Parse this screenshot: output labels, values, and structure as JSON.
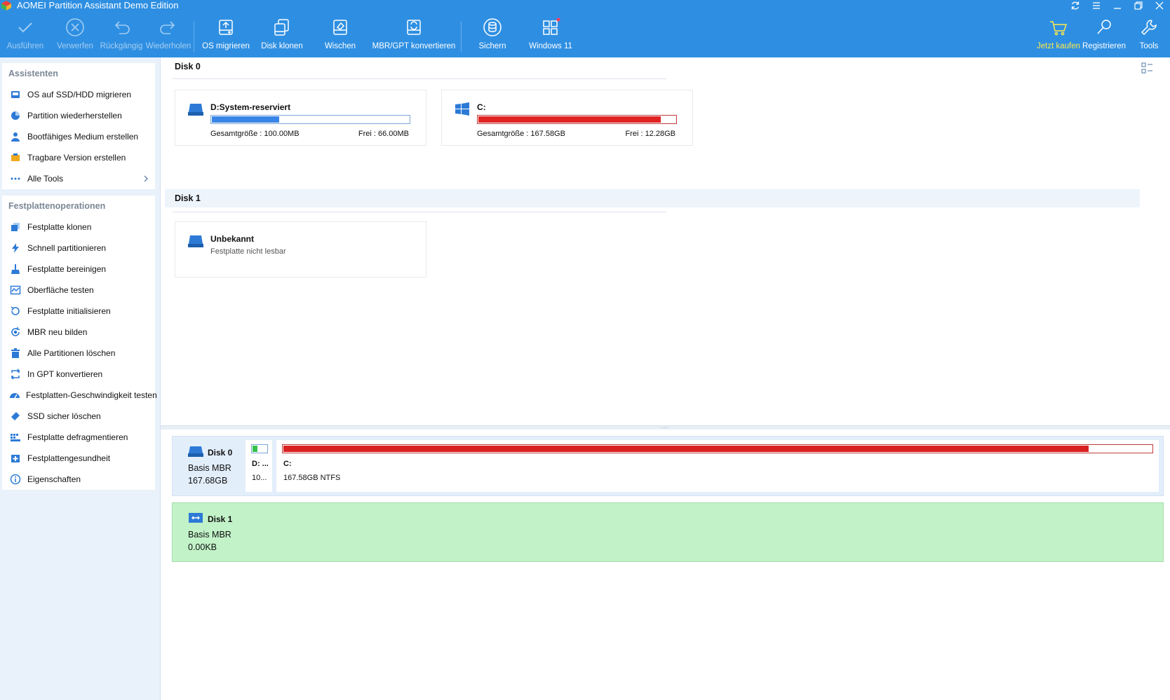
{
  "app": {
    "title": "AOMEI Partition Assistant Demo Edition"
  },
  "toolbar": {
    "items": [
      {
        "label": "Ausführen",
        "icon": "check-icon",
        "enabled": false
      },
      {
        "label": "Verwerfen",
        "icon": "discard-icon",
        "enabled": false
      },
      {
        "label": "Rückgängig",
        "icon": "undo-icon",
        "enabled": false
      },
      {
        "label": "Wiederholen",
        "icon": "redo-icon",
        "enabled": false
      },
      {
        "label": "OS migrieren",
        "icon": "migrate-os-icon",
        "enabled": true
      },
      {
        "label": "Disk klonen",
        "icon": "clone-disk-icon",
        "enabled": true
      },
      {
        "label": "Wischen",
        "icon": "wipe-icon",
        "enabled": true
      },
      {
        "label": "MBR/GPT konvertieren",
        "icon": "convert-icon",
        "enabled": true
      },
      {
        "label": "Sichern",
        "icon": "backup-icon",
        "enabled": true
      },
      {
        "label": "Windows 11",
        "icon": "windows11-icon",
        "enabled": true
      }
    ],
    "right_items": [
      {
        "label": "Jetzt kaufen",
        "icon": "cart-icon"
      },
      {
        "label": "Registrieren",
        "icon": "key-icon"
      },
      {
        "label": "Tools",
        "icon": "tools-icon"
      }
    ]
  },
  "sidebar": {
    "assistants": {
      "heading": "Assistenten",
      "items": [
        {
          "label": "OS auf SSD/HDD migrieren",
          "icon": "migrate-icon"
        },
        {
          "label": "Partition wiederherstellen",
          "icon": "recover-icon"
        },
        {
          "label": "Bootfähiges Medium erstellen",
          "icon": "bootable-media-icon"
        },
        {
          "label": "Tragbare Version erstellen",
          "icon": "portable-icon"
        },
        {
          "label": "Alle Tools",
          "icon": "more-icon"
        }
      ]
    },
    "disk_ops": {
      "heading": "Festplattenoperationen",
      "items": [
        {
          "label": "Festplatte klonen",
          "icon": "clone-icon"
        },
        {
          "label": "Schnell partitionieren",
          "icon": "lightning-icon"
        },
        {
          "label": "Festplatte bereinigen",
          "icon": "broom-icon"
        },
        {
          "label": "Oberfläche testen",
          "icon": "surface-test-icon"
        },
        {
          "label": "Festplatte initialisieren",
          "icon": "initialize-icon"
        },
        {
          "label": "MBR neu bilden",
          "icon": "rebuild-mbr-icon"
        },
        {
          "label": "Alle Partitionen löschen",
          "icon": "trash-icon"
        },
        {
          "label": "In GPT konvertieren",
          "icon": "convert-gpt-icon"
        },
        {
          "label": "Festplatten-Geschwindigkeit testen",
          "icon": "speedometer-icon"
        },
        {
          "label": "SSD sicher löschen",
          "icon": "eraser-icon"
        },
        {
          "label": "Festplatte defragmentieren",
          "icon": "defrag-icon"
        },
        {
          "label": "Festplattengesundheit",
          "icon": "health-icon"
        },
        {
          "label": "Eigenschaften",
          "icon": "info-icon"
        }
      ]
    }
  },
  "main": {
    "disk0": {
      "title": "Disk 0",
      "partitions": [
        {
          "name": "D:System-reserviert",
          "total_label": "Gesamtgröße : 100.00MB",
          "free_label": "Frei : 66.00MB",
          "used_fraction": 0.34,
          "color": "#3a86e8"
        },
        {
          "name": "C:",
          "total_label": "Gesamtgröße : 167.58GB",
          "free_label": "Frei : 12.28GB",
          "used_fraction": 0.927,
          "color": "#e02424"
        }
      ]
    },
    "disk1": {
      "title": "Disk 1",
      "partitions": [
        {
          "name": "Unbekannt",
          "sub": "Festplatte nicht lesbar"
        }
      ]
    }
  },
  "diskmap": {
    "disk0": {
      "title": "Disk 0",
      "type": "Basis MBR",
      "size": "167.68GB",
      "parts": [
        {
          "label": "D: ...",
          "sub": "10...",
          "used_fraction": 0.34,
          "color": "#33c24d"
        },
        {
          "label": "C:",
          "sub": "167.58GB NTFS",
          "used_fraction": 0.927,
          "color": "#d92020"
        }
      ]
    },
    "disk1": {
      "title": "Disk 1",
      "type": "Basis MBR",
      "size": "0.00KB",
      "bg": "#c2f3c8"
    }
  }
}
